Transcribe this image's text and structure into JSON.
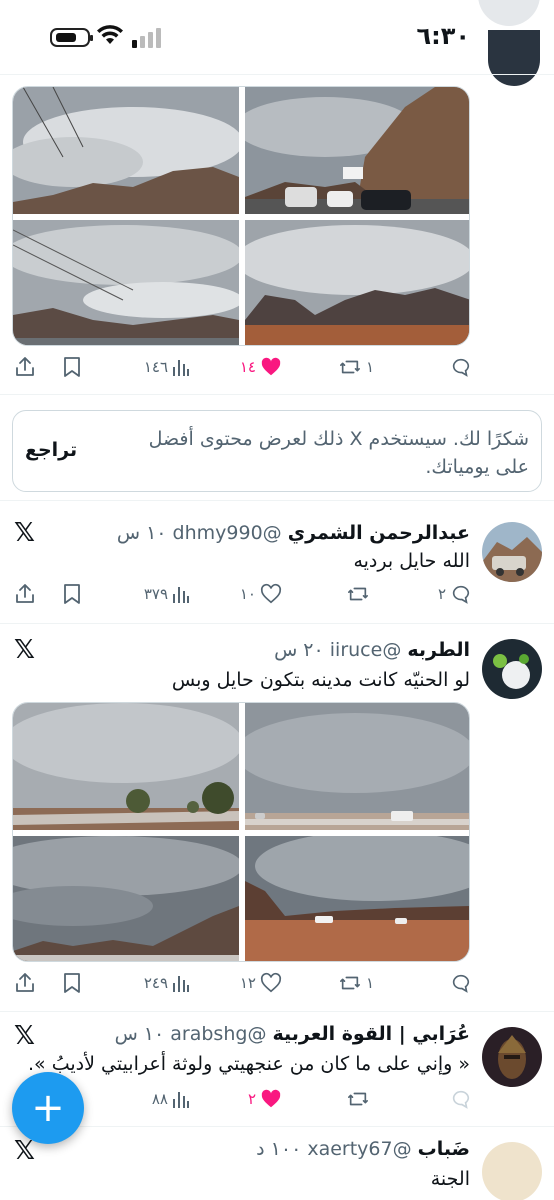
{
  "status_bar": {
    "time": "٦:٣٠"
  },
  "feed": [
    {
      "id": "post-top",
      "stats": {
        "views": "١٤٦",
        "likes": "١٤",
        "retweets": "١",
        "replies": ""
      },
      "liked": true
    },
    {
      "id": "post-dhmy",
      "name": "عبدالرحمن الشمري",
      "handle": "@dhmy990",
      "time": "١٠ س",
      "text": "الله حايل برديه",
      "stats": {
        "views": "٣٧٩",
        "likes": "١٠",
        "retweets": "",
        "replies": "٢"
      },
      "liked": false
    },
    {
      "id": "post-iiruce",
      "name": "الطربه",
      "handle": "@iiruce",
      "time": "٢٠ س",
      "text": "لو الحنيّه كانت مدينه بتكون حايل وبس",
      "stats": {
        "views": "٢٤٩",
        "likes": "١٢",
        "retweets": "١",
        "replies": ""
      },
      "liked": false
    },
    {
      "id": "post-arabshg",
      "name": "عُرَابي | القوة العربية",
      "handle": "@arabshg",
      "time": "١٠ س",
      "text": "« وإني على ما كان من عنجهيتي ولوثة أعرابيتي لأديبُ ».",
      "stats": {
        "views": "٨٨",
        "likes": "٢",
        "retweets": "",
        "replies": ""
      },
      "liked": true
    },
    {
      "id": "post-xaerty",
      "name": "ضَباب",
      "handle": "@xaerty67",
      "time": "١٠٠ د",
      "text": "الجنة"
    }
  ],
  "feedback": {
    "message": "شكرًا لك. سيستخدم X ذلك  لعرض محتوى أفضل على يومياتك.",
    "undo_label": "تراجع"
  },
  "fab": {
    "label": "+"
  },
  "colors": {
    "accent": "#1d9bf0",
    "like": "#f91880",
    "muted": "#536471"
  }
}
